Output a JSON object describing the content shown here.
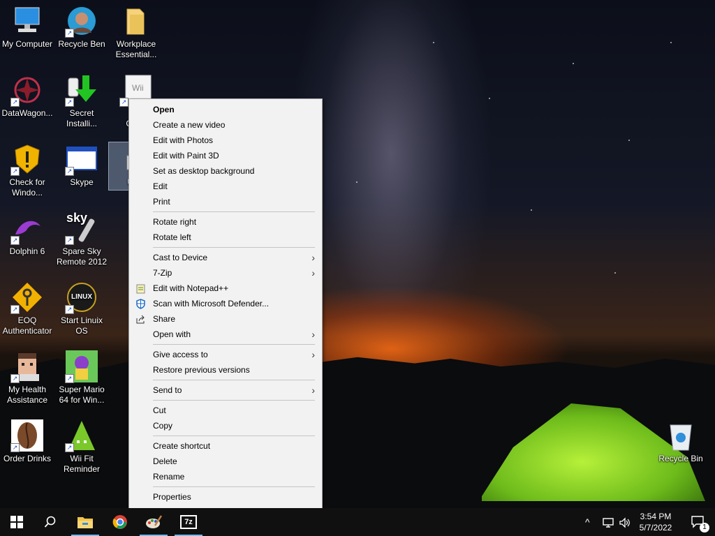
{
  "desktop": {
    "icons": [
      {
        "label_lines": [
          "My Computer"
        ],
        "icon": "computer-icon"
      },
      {
        "label_lines": [
          "Recycle Ben"
        ],
        "icon": "person-photo-icon"
      },
      {
        "label_lines": [
          "Workplace",
          "Essential..."
        ],
        "icon": "folder-icon"
      },
      {
        "label_lines": [
          "DataWagon..."
        ],
        "icon": "mandala-icon"
      },
      {
        "label_lines": [
          "Secret",
          "Installi..."
        ],
        "icon": "download-arrow-icon"
      },
      {
        "label_lines": [
          "Wii",
          "Ger..."
        ],
        "icon": "wii-icon"
      },
      {
        "label_lines": [
          "Check for",
          "Windo..."
        ],
        "icon": "shield-warning-icon"
      },
      {
        "label_lines": [
          "Skype"
        ],
        "icon": "window-icon"
      },
      {
        "label_lines": [
          "Un..."
        ],
        "icon": "image-file-icon"
      },
      {
        "label_lines": [
          "Dolphin 6"
        ],
        "icon": "dolphin-icon"
      },
      {
        "label_lines": [
          "Spare Sky",
          "Remote 2012"
        ],
        "icon": "remote-icon"
      },
      {
        "label_lines": [
          "EOQ",
          "Authenticator"
        ],
        "icon": "key-icon"
      },
      {
        "label_lines": [
          "Start Linuix",
          "OS"
        ],
        "icon": "linux-icon"
      },
      {
        "label_lines": [
          "My Health",
          "Assistance"
        ],
        "icon": "pixel-face-icon"
      },
      {
        "label_lines": [
          "Super Mario",
          "64 for Win..."
        ],
        "icon": "game-character-icon"
      },
      {
        "label_lines": [
          "Order Drinks"
        ],
        "icon": "coffee-bean-icon"
      },
      {
        "label_lines": [
          "Wii Fit",
          "Reminder"
        ],
        "icon": "pixel-triangle-icon"
      },
      {
        "label_lines": [
          "Recycle Bin"
        ],
        "icon": "recycle-bin-icon"
      }
    ],
    "sky_label": "sky",
    "wii_label": "Wii",
    "linux_label": "LINUX"
  },
  "context_menu": {
    "items": [
      {
        "label": "Open",
        "bold": true
      },
      {
        "label": "Create a new video"
      },
      {
        "label": "Edit with Photos"
      },
      {
        "label": "Edit with Paint 3D"
      },
      {
        "label": "Set as desktop background"
      },
      {
        "label": "Edit"
      },
      {
        "label": "Print"
      },
      {
        "label": "Rotate right"
      },
      {
        "label": "Rotate left"
      },
      {
        "label": "Cast to Device",
        "submenu": true
      },
      {
        "label": "7-Zip",
        "submenu": true
      },
      {
        "label": "Edit with Notepad++",
        "icon": "notepad-icon"
      },
      {
        "label": "Scan with Microsoft Defender...",
        "icon": "defender-shield-icon"
      },
      {
        "label": "Share",
        "icon": "share-icon"
      },
      {
        "label": "Open with",
        "submenu": true
      },
      {
        "label": "Give access to",
        "submenu": true
      },
      {
        "label": "Restore previous versions"
      },
      {
        "label": "Send to",
        "submenu": true
      },
      {
        "label": "Cut"
      },
      {
        "label": "Copy"
      },
      {
        "label": "Create shortcut"
      },
      {
        "label": "Delete"
      },
      {
        "label": "Rename"
      },
      {
        "label": "Properties"
      }
    ],
    "submenu_glyph": "›"
  },
  "taskbar": {
    "pinned": [
      "start-icon",
      "search-icon",
      "file-explorer-icon",
      "chrome-icon",
      "paint-icon",
      "7zip-icon"
    ],
    "sevenzip_label": "7z",
    "tray": {
      "chevron": "^",
      "notification_count": "1"
    },
    "clock": {
      "time": "3:54 PM",
      "date": "5/7/2022"
    }
  }
}
